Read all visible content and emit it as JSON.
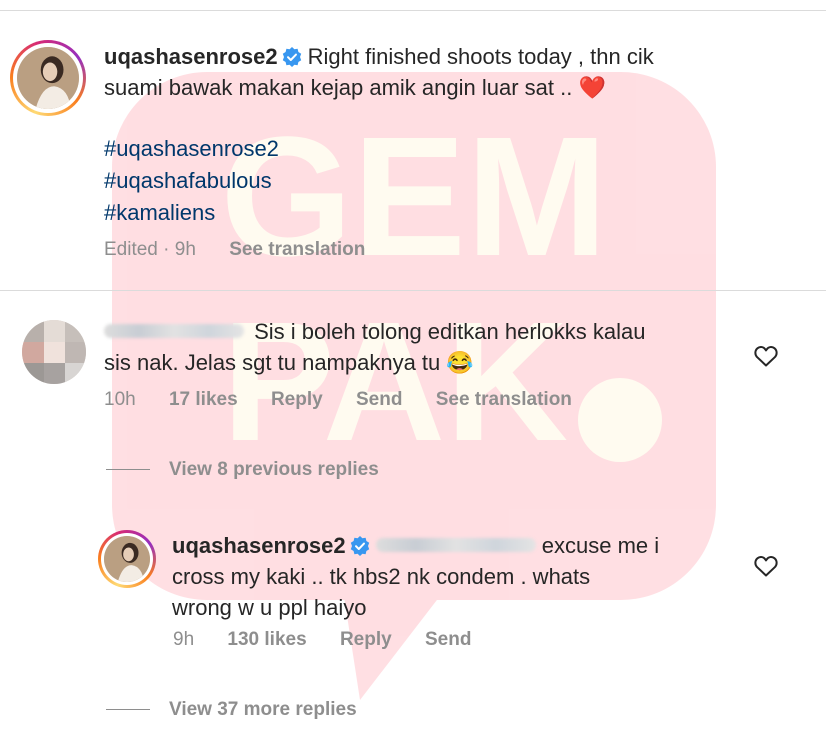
{
  "post": {
    "username": "uqashasenrose2",
    "caption_line1": "Right finished shoots today , thn cik",
    "caption_line2": "suami bawak makan kejap amik angin luar sat .. ❤️",
    "hashtags": [
      "#uqashasenrose2",
      "#uqashafabulous",
      "#kamaliens"
    ],
    "edited_label": "Edited",
    "time": "9h",
    "translate_label": "See translation"
  },
  "comment": {
    "line1": "Sis i boleh tolong editkan herlokks kalau",
    "line2": "sis nak. Jelas sgt tu nampaknya tu 😂",
    "time": "10h",
    "likes": "17 likes",
    "reply_label": "Reply",
    "send_label": "Send",
    "translate_label": "See translation"
  },
  "view_previous": "View 8 previous replies",
  "reply": {
    "username": "uqashasenrose2",
    "line1_tail": "excuse me i",
    "line2": "cross my kaki .. tk hbs2 nk condem . whats",
    "line3": "wrong w u ppl haiyo",
    "time": "9h",
    "likes": "130 likes",
    "reply_label": "Reply",
    "send_label": "Send"
  },
  "view_more": "View 37 more replies",
  "colors": {
    "watermark": "#ff3b52",
    "watermark_text": "#ffe9a6",
    "hashtag": "#00376b",
    "verified": "#3897f0",
    "meta": "#8e8e8e"
  }
}
